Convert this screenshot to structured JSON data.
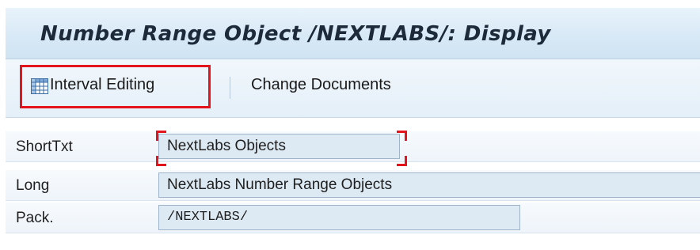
{
  "window": {
    "title": "Number Range Object /NEXTLABS/: Display"
  },
  "toolbar": {
    "interval_editing_label": "Interval Editing",
    "change_documents_label": "Change Documents",
    "interval_editing_icon": "table-grid-icon",
    "highlight_color": "#e4141c"
  },
  "form": {
    "short_text": {
      "label": "ShortTxt",
      "value": "NextLabs Objects"
    },
    "long_text": {
      "label": "Long",
      "value": "NextLabs Number Range Objects"
    },
    "package": {
      "label": "Pack.",
      "value": "/NEXTLABS/"
    }
  },
  "colors": {
    "title_bar": "#d8e9f6",
    "field_background": "#dde9f3",
    "highlight": "#e4141c"
  }
}
